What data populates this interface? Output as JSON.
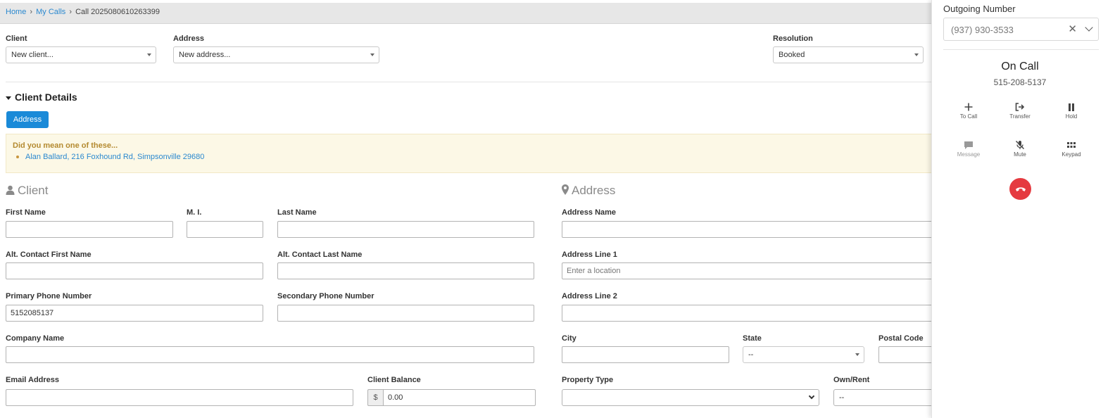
{
  "breadcrumb": {
    "home": "Home",
    "separator": "›",
    "my_calls": "My Calls",
    "current": "Call 2025080610263399"
  },
  "top_fields": {
    "client": {
      "label": "Client",
      "value": "New client..."
    },
    "address": {
      "label": "Address",
      "value": "New address..."
    },
    "resolution": {
      "label": "Resolution",
      "value": "Booked"
    }
  },
  "client_details": {
    "title": "Client Details",
    "address_button": "Address",
    "suggestion": {
      "title": "Did you mean one of these...",
      "items": [
        "Alan Ballard, 216 Foxhound Rd, Simpsonville 29680"
      ]
    }
  },
  "client_form": {
    "heading": "Client",
    "first_name": {
      "label": "First Name",
      "value": ""
    },
    "mi": {
      "label": "M. I.",
      "value": ""
    },
    "last_name": {
      "label": "Last Name",
      "value": ""
    },
    "alt_first": {
      "label": "Alt. Contact First Name",
      "value": ""
    },
    "alt_last": {
      "label": "Alt. Contact Last Name",
      "value": ""
    },
    "primary_phone": {
      "label": "Primary Phone Number",
      "value": "5152085137"
    },
    "secondary_phone": {
      "label": "Secondary Phone Number",
      "value": ""
    },
    "company": {
      "label": "Company Name",
      "value": ""
    },
    "email": {
      "label": "Email Address",
      "value": ""
    },
    "balance": {
      "label": "Client Balance",
      "currency": "$",
      "value": "0.00"
    }
  },
  "address_form": {
    "heading": "Address",
    "address_name": {
      "label": "Address Name",
      "value": ""
    },
    "line1": {
      "label": "Address Line 1",
      "value": "",
      "placeholder": "Enter a location"
    },
    "line2": {
      "label": "Address Line 2",
      "value": ""
    },
    "city": {
      "label": "City",
      "value": ""
    },
    "state": {
      "label": "State",
      "value": "--"
    },
    "postal": {
      "label": "Postal Code",
      "value": ""
    },
    "property_type": {
      "label": "Property Type",
      "value": ""
    },
    "own_rent": {
      "label": "Own/Rent",
      "value": "--"
    }
  },
  "call_panel": {
    "outgoing_label": "Outgoing Number",
    "outgoing_value": "(937) 930-3533",
    "status": "On Call",
    "number": "515-208-5137",
    "actions": [
      {
        "label": "To Call",
        "icon": "plus-icon"
      },
      {
        "label": "Transfer",
        "icon": "transfer-icon"
      },
      {
        "label": "Hold",
        "icon": "pause-icon"
      },
      {
        "label": "Message",
        "icon": "message-icon"
      },
      {
        "label": "Mute",
        "icon": "mic-off-icon"
      },
      {
        "label": "Keypad",
        "icon": "keypad-icon"
      }
    ],
    "hangup_color": "#e53a40"
  },
  "colors": {
    "link": "#2a88cf",
    "primary_button": "#1a8ad8",
    "warning_bg": "#fcf8e6",
    "warning_text": "#b48a30"
  }
}
